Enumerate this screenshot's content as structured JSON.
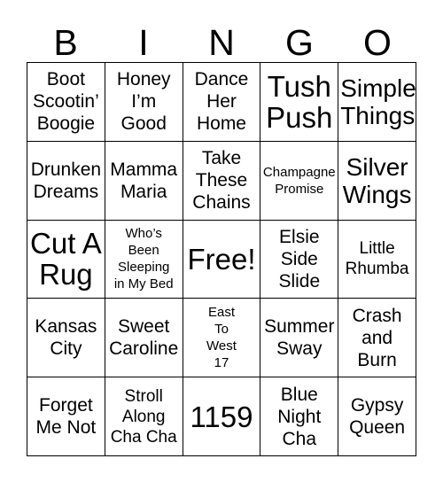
{
  "card": {
    "title": "BINGO",
    "header_letters": [
      "B",
      "I",
      "N",
      "G",
      "O"
    ],
    "columns": 5,
    "rows": 5,
    "colors": {
      "background": "#ffffff",
      "text": "#000000",
      "grid_line": "#000000"
    },
    "free_space": {
      "row": 3,
      "column": 3,
      "label": "Free!"
    },
    "rows_data": [
      [
        {
          "text": "Boot\nScootin’\nBoogie",
          "size": "md"
        },
        {
          "text": "Honey\nI’m\nGood",
          "size": "md"
        },
        {
          "text": "Dance\nHer\nHome",
          "size": "md"
        },
        {
          "text": "Tush\nPush",
          "size": "xl"
        },
        {
          "text": "Simple\nThings",
          "size": "lg"
        }
      ],
      [
        {
          "text": "Drunken\nDreams",
          "size": "md"
        },
        {
          "text": "Mamma\nMaria",
          "size": "md"
        },
        {
          "text": "Take\nThese\nChains",
          "size": "md"
        },
        {
          "text": "Champagne\nPromise",
          "size": "xs"
        },
        {
          "text": "Silver\nWings",
          "size": "lg"
        }
      ],
      [
        {
          "text": "Cut A\nRug",
          "size": "xl"
        },
        {
          "text": "Who’s\nBeen\nSleeping\nin My Bed",
          "size": "xs"
        },
        {
          "text": "Free!",
          "size": "xl"
        },
        {
          "text": "Elsie\nSide\nSlide",
          "size": "md"
        },
        {
          "text": "Little\nRhumba",
          "size": "sm"
        }
      ],
      [
        {
          "text": "Kansas\nCity",
          "size": "md"
        },
        {
          "text": "Sweet\nCaroline",
          "size": "md"
        },
        {
          "text": "East\nTo\nWest\n17",
          "size": "xs"
        },
        {
          "text": "Summer\nSway",
          "size": "md"
        },
        {
          "text": "Crash\nand\nBurn",
          "size": "md"
        }
      ],
      [
        {
          "text": "Forget\nMe Not",
          "size": "md"
        },
        {
          "text": "Stroll\nAlong\nCha Cha",
          "size": "sm"
        },
        {
          "text": "1159",
          "size": "xl"
        },
        {
          "text": "Blue\nNight\nCha",
          "size": "md"
        },
        {
          "text": "Gypsy\nQueen",
          "size": "md"
        }
      ]
    ]
  }
}
